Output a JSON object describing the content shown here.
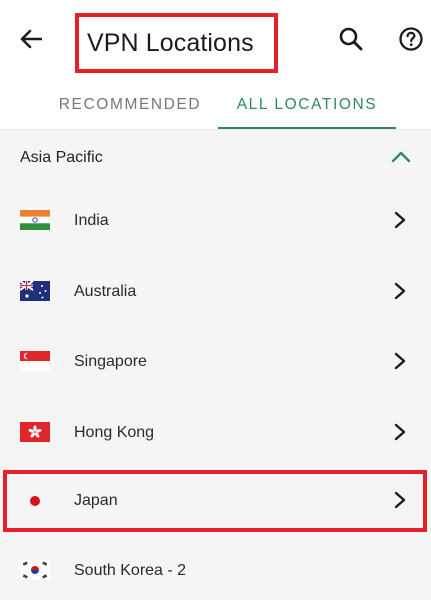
{
  "header": {
    "title": "VPN Locations"
  },
  "tabs": [
    {
      "label": "RECOMMENDED",
      "selected": false
    },
    {
      "label": "ALL LOCATIONS",
      "selected": true
    }
  ],
  "section": {
    "title": "Asia Pacific",
    "expanded": true
  },
  "locations": [
    {
      "label": "India",
      "flag": "india-flag-icon"
    },
    {
      "label": "Australia",
      "flag": "australia-flag-icon"
    },
    {
      "label": "Singapore",
      "flag": "singapore-flag-icon"
    },
    {
      "label": "Hong Kong",
      "flag": "hong-kong-flag-icon"
    },
    {
      "label": "Japan",
      "flag": "japan-flag-icon",
      "highlighted": true
    },
    {
      "label": "South Korea - 2",
      "flag": "south-korea-flag-icon"
    }
  ],
  "colors": {
    "accent": "#2f8a5f",
    "highlight_border": "#e32128",
    "list_background": "#f5f5f5"
  }
}
